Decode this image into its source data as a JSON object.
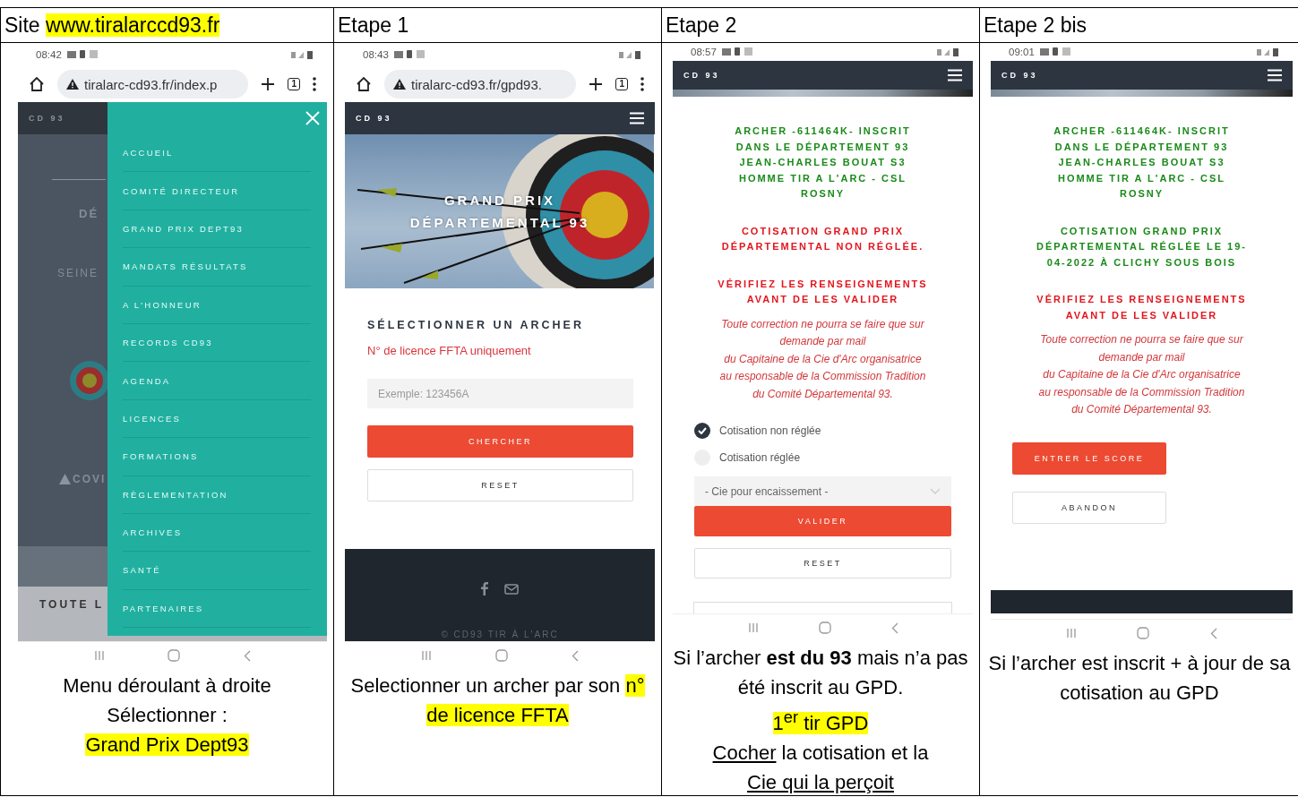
{
  "columns": [
    {
      "header": [
        {
          "text": "Site ",
          "kind": "plain"
        },
        {
          "text": "www.tiralarccd93.fr",
          "kind": "highlight"
        }
      ],
      "phone": {
        "kind": "menu",
        "status_time": "08:42",
        "browser_url": "tiralarc-cd93.fr/index.p",
        "tab_count": "1",
        "site_name": "CD 93",
        "background": {
          "heading": "DÉ",
          "subtitle": "SEINE",
          "notice": "COVI",
          "section": "TOUTE L"
        },
        "menu_items": [
          {
            "label": "ACCUEIL"
          },
          {
            "label": "COMITÉ DIRECTEUR"
          },
          {
            "label": "GRAND PRIX DEPT93"
          },
          {
            "label": "MANDATS RÉSULTATS"
          },
          {
            "label": "A L'HONNEUR"
          },
          {
            "label": "RECORDS CD93"
          },
          {
            "label": "AGENDA"
          },
          {
            "label": "LICENCES"
          },
          {
            "label": "FORMATIONS"
          },
          {
            "label": "RÈGLEMENTATION"
          },
          {
            "label": "ARCHIVES"
          },
          {
            "label": "SANTÉ"
          },
          {
            "label": "PARTENAIRES"
          }
        ]
      },
      "caption": [
        [
          {
            "text": "Menu déroulant à droite",
            "kind": "plain"
          }
        ],
        [
          {
            "text": "Sélectionner :",
            "kind": "plain"
          }
        ],
        [
          {
            "text": "Grand Prix Dept93",
            "kind": "highlight"
          }
        ]
      ]
    },
    {
      "header": [
        {
          "text": "Etape 1",
          "kind": "plain"
        }
      ],
      "phone": {
        "kind": "search",
        "status_time": "08:43",
        "browser_url": "tiralarc-cd93.fr/gpd93.",
        "tab_count": "1",
        "site_name": "CD 93",
        "hero_title": [
          "GRAND PRIX",
          "DÉPARTEMENTAL 93"
        ],
        "section_title": "SÉLECTIONNER UN ARCHER",
        "hint": "N° de licence FFTA uniquement",
        "input_placeholder": "Exemple: 123456A",
        "buttons": [
          {
            "label": "CHERCHER",
            "kind": "primary"
          },
          {
            "label": "RESET",
            "kind": "secondary"
          }
        ],
        "footer_text": "© CD93 TIR À L'ARC"
      },
      "caption": [
        [
          {
            "text": "Selectionner un archer par son ",
            "kind": "plain"
          },
          {
            "text": "n° de licence FFTA",
            "kind": "highlight"
          }
        ]
      ]
    },
    {
      "header": [
        {
          "text": "Etape 2",
          "kind": "plain"
        }
      ],
      "phone": {
        "kind": "archer",
        "status_time": "08:57",
        "site_name": "CD 93",
        "bottom": {
          "kind": "cut-button"
        },
        "blocks": [
          {
            "kind": "success_heading",
            "lines": [
              "ARCHER -611464K- INSCRIT",
              "DANS LE DÉPARTEMENT 93",
              "JEAN-CHARLES BOUAT S3",
              "HOMME TIR A L'ARC - CSL",
              "ROSNY"
            ]
          },
          {
            "kind": "error_heading",
            "lines": [
              "COTISATION GRAND PRIX",
              "DÉPARTEMENTAL NON RÉGLÉE."
            ]
          },
          {
            "kind": "error_heading",
            "lines": [
              "VÉRIFIEZ LES RENSEIGNEMENTS",
              "AVANT DE LES VALIDER"
            ]
          },
          {
            "kind": "note",
            "lines": [
              "Toute correction ne pourra se faire que sur",
              "demande par mail",
              "du Capitaine de la Cie d'Arc organisatrice",
              "au responsable de la Commission Tradition",
              "du Comité Départemental 93."
            ]
          },
          {
            "kind": "radios",
            "options": [
              {
                "label": "Cotisation non réglée",
                "selected": true
              },
              {
                "label": "Cotisation réglée",
                "selected": false
              }
            ]
          },
          {
            "kind": "select",
            "value": "- Cie pour encaissement -"
          },
          {
            "kind": "full_actions",
            "buttons": [
              {
                "label": "VALIDER",
                "kind": "primary"
              },
              {
                "label": "RESET",
                "kind": "secondary"
              }
            ]
          }
        ]
      },
      "caption": [
        [
          {
            "text": "Si l’archer **est du 93** mais n’a pas été inscrit au GPD.",
            "kind": "plain"
          }
        ],
        [
          {
            "text": "1$^{er}$ tir GPD",
            "kind": "highlight"
          }
        ],
        [
          {
            "text": "Cocher",
            "kind": "underline"
          },
          {
            "text": " la cotisation et la",
            "kind": "plain"
          }
        ],
        [
          {
            "text": "Cie qui la perçoit",
            "kind": "underline"
          }
        ]
      ]
    },
    {
      "header": [
        {
          "text": "Etape 2 bis",
          "kind": "plain"
        }
      ],
      "phone": {
        "kind": "archer",
        "status_time": "09:01",
        "site_name": "CD 93",
        "bottom": {
          "kind": "footer"
        },
        "blocks": [
          {
            "kind": "success_heading",
            "lines": [
              "ARCHER -611464K- INSCRIT",
              "DANS LE DÉPARTEMENT 93",
              "JEAN-CHARLES BOUAT S3",
              "HOMME TIR A L'ARC - CSL",
              "ROSNY"
            ]
          },
          {
            "kind": "success_heading",
            "lines": [
              "COTISATION GRAND PRIX",
              "DÉPARTEMENTAL RÉGLÉE LE 19-",
              "04-2022 À CLICHY SOUS BOIS"
            ]
          },
          {
            "kind": "error_heading",
            "lines": [
              "VÉRIFIEZ LES RENSEIGNEMENTS",
              "AVANT DE LES VALIDER"
            ]
          },
          {
            "kind": "note",
            "lines": [
              "Toute correction ne pourra se faire que sur",
              "demande par mail",
              "du Capitaine de la Cie d'Arc organisatrice",
              "au responsable de la Commission Tradition",
              "du Comité Départemental 93."
            ]
          },
          {
            "kind": "half_actions",
            "buttons": [
              {
                "label": "ENTRER LE SCORE",
                "kind": "primary"
              },
              {
                "label": "ABANDON",
                "kind": "secondary"
              }
            ]
          }
        ]
      },
      "caption": [
        [
          {
            "text": "Si l’archer est inscrit + à jour de sa cotisation au GPD",
            "kind": "plain"
          }
        ]
      ]
    }
  ]
}
